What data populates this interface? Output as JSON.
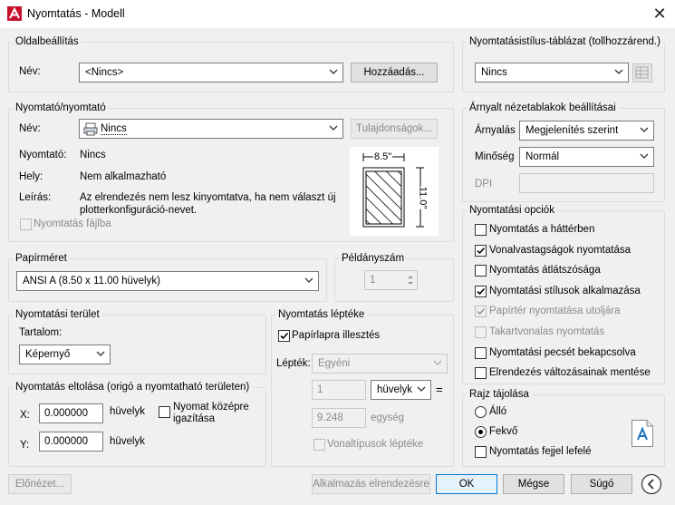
{
  "window": {
    "title": "Nyomtatás - Modell",
    "close": "✕"
  },
  "page_setup": {
    "legend": "Oldalbeállítás",
    "name_label": "Név:",
    "name_value": "<Nincs>",
    "add_button": "Hozzáadás..."
  },
  "printer": {
    "legend": "Nyomtató/nyomtató",
    "name_label": "Név:",
    "name_value": "Nincs",
    "properties_button": "Tulajdonságok...",
    "plotter_label": "Nyomtató:",
    "plotter_value": "Nincs",
    "where_label": "Hely:",
    "where_value": "Nem alkalmazható",
    "desc_label": "Leírás:",
    "desc_line1": "Az elrendezés nem lesz kinyomtatva, ha nem választ új",
    "desc_line2": "plotterkonfiguráció-nevet.",
    "print_to_file": "Nyomtatás fájlba",
    "paper_width": "8.5\"",
    "paper_height": "11.0\""
  },
  "paper_size": {
    "legend": "Papírméret",
    "value": "ANSI A (8.50 x 11.00 hüvelyk)"
  },
  "copies": {
    "legend": "Példányszám",
    "value": "1"
  },
  "plot_area": {
    "legend": "Nyomtatási terület",
    "what_label": "Tartalom:",
    "what_value": "Képernyő"
  },
  "plot_offset": {
    "legend": "Nyomtatás eltolása (origó a nyomtatható területen)",
    "x_label": "X:",
    "x_value": "0.000000",
    "x_unit": "hüvelyk",
    "y_label": "Y:",
    "y_value": "0.000000",
    "y_unit": "hüvelyk",
    "center_line1": "Nyomat középre",
    "center_line2": "igazítása"
  },
  "plot_scale": {
    "legend": "Nyomtatás léptéke",
    "fit": "Papírlapra illesztés",
    "scale_label": "Lépték:",
    "scale_value": "Egyéni",
    "value1": "1",
    "unit1": "hüvelyk",
    "equals": "=",
    "value2": "9.248",
    "unit2": "egység",
    "lineweights": "Vonaltípusok léptéke"
  },
  "style_table": {
    "legend": "Nyomtatásistílus-táblázat (tollhozzárend.)",
    "value": "Nincs"
  },
  "shaded": {
    "legend": "Árnyalt nézetablakok beállításai",
    "shade_label": "Árnyalás",
    "shade_value": "Megjelenítés szerint",
    "quality_label": "Minőség",
    "quality_value": "Normál",
    "dpi_label": "DPI"
  },
  "options": {
    "legend": "Nyomtatási opciók",
    "items": [
      {
        "label": "Nyomtatás a háttérben",
        "checked": false,
        "disabled": false
      },
      {
        "label": "Vonalvastagságok nyomtatása",
        "checked": true,
        "disabled": false
      },
      {
        "label": "Nyomtatás átlátszósága",
        "checked": false,
        "disabled": false
      },
      {
        "label": "Nyomtatási stílusok alkalmazása",
        "checked": true,
        "disabled": false
      },
      {
        "label": "Papírtér nyomtatása utoljára",
        "checked": true,
        "disabled": true
      },
      {
        "label": "Takartvonalas nyomtatás",
        "checked": false,
        "disabled": true
      },
      {
        "label": "Nyomtatási pecsét bekapcsolva",
        "checked": false,
        "disabled": false
      },
      {
        "label": "Elrendezés változásainak mentése",
        "checked": false,
        "disabled": false
      }
    ]
  },
  "orientation": {
    "legend": "Rajz tájolása",
    "portrait": "Álló",
    "landscape": "Fekvő",
    "upside_down": "Nyomtatás fejjel lefelé",
    "selected": "landscape"
  },
  "footer": {
    "preview": "Előnézet...",
    "apply": "Alkalmazás elrendezésre",
    "ok": "OK",
    "cancel": "Mégse",
    "help": "Súgó"
  },
  "colors": {
    "accent": "#0078d7",
    "logo_red": "#c8102e"
  }
}
